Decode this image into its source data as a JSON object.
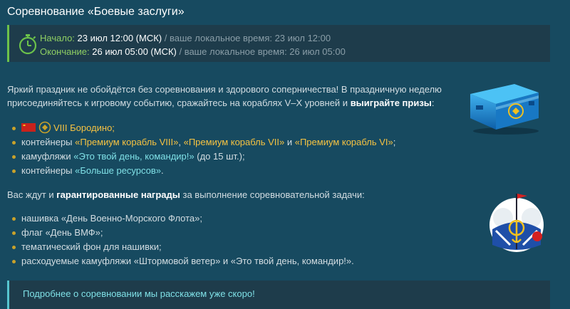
{
  "title": "Соревнование «Боевые заслуги»",
  "dates": {
    "start_label": "Начало:",
    "start_value": "23 июл 12:00 (МСК)",
    "start_local": " / ваше локальное время: 23 июл 12:00",
    "end_label": "Окончание:",
    "end_value": "26 июл 05:00 (МСК)",
    "end_local": " / ваше локальное время: 26 июл 05:00",
    "icon": "stopwatch-icon"
  },
  "intro": {
    "text": "Яркий праздник не обойдётся без соревнования и здорового соперничества! В праздничную неделю присоединяйтесь к игровому событию, сражайтесь на кораблях V–X уровней и ",
    "bold": "выиграйте призы",
    "tail": ":"
  },
  "prizes": {
    "item1": {
      "text": "VIII Бородино;",
      "flag_icon": "ussr-flag-icon",
      "rank_icon": "tier-viii-icon"
    },
    "item2": {
      "p1": "контейнеры ",
      "h1": "«Премиум корабль VIII»",
      "p2": ", ",
      "h2": "«Премиум корабль VII»",
      "p3": " и ",
      "h3": "«Премиум корабль VI»",
      "p4": ";"
    },
    "item3": {
      "p1": "камуфляжи ",
      "h1": "«Это твой день, командир!»",
      "p2": " (до 15 шт.);"
    },
    "item4": {
      "p1": "контейнеры ",
      "h1": "«Больше ресурсов»",
      "p2": "."
    }
  },
  "rewards_intro": {
    "p1": "Вас ждут и ",
    "bold": "гарантированные награды",
    "p2": " за выполнение соревновательной задачи:"
  },
  "rewards": [
    "нашивка «День Военно-Морского Флота»;",
    "флаг «День ВМФ»;",
    "тематический фон для нашивки;",
    "расходуемые камуфляжи «Штормовой ветер» и «Это твой день, командир!»."
  ],
  "footer": {
    "text": "Подробнее о соревновании мы расскажем уже скоро!"
  },
  "colors": {
    "background": "#174a60",
    "box": "#1e3c4b",
    "green_accent": "#6cc24a",
    "cyan_accent": "#56c6d0",
    "highlight_yellow": "#f5c242",
    "highlight_cyan": "#7fe0e6"
  }
}
